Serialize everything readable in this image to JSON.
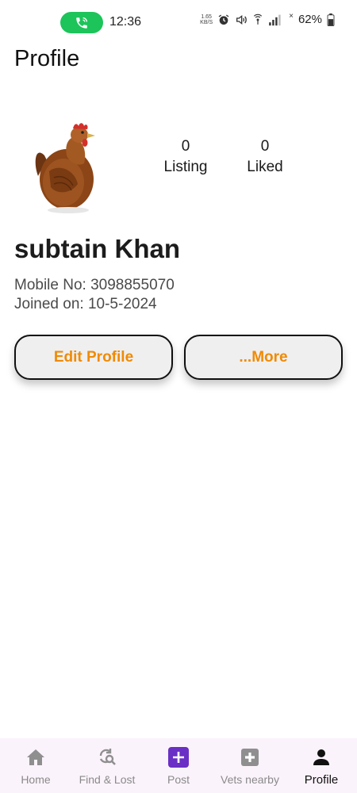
{
  "status_bar": {
    "time": "12:36",
    "net_speed_value": "1.65",
    "net_speed_unit": "KB/S",
    "battery": "62%"
  },
  "header": {
    "title": "Profile"
  },
  "profile": {
    "avatar_icon": "chicken-photo",
    "stats": [
      {
        "count": "0",
        "label": "Listing"
      },
      {
        "count": "0",
        "label": "Liked"
      }
    ],
    "name": "subtain Khan",
    "mobile": "Mobile No: 3098855070",
    "joined": "Joined on: 10-5-2024"
  },
  "actions": {
    "edit_label": "Edit Profile",
    "more_label": "...More",
    "accent_color": "#F08A05"
  },
  "bottom_nav": {
    "items": [
      {
        "label": "Home",
        "icon": "home-icon"
      },
      {
        "label": "Find & Lost",
        "icon": "find-lost-icon"
      },
      {
        "label": "Post",
        "icon": "add-post-icon"
      },
      {
        "label": "Vets nearby",
        "icon": "medical-cross-icon"
      },
      {
        "label": "Profile",
        "icon": "person-icon",
        "active": true
      }
    ]
  }
}
